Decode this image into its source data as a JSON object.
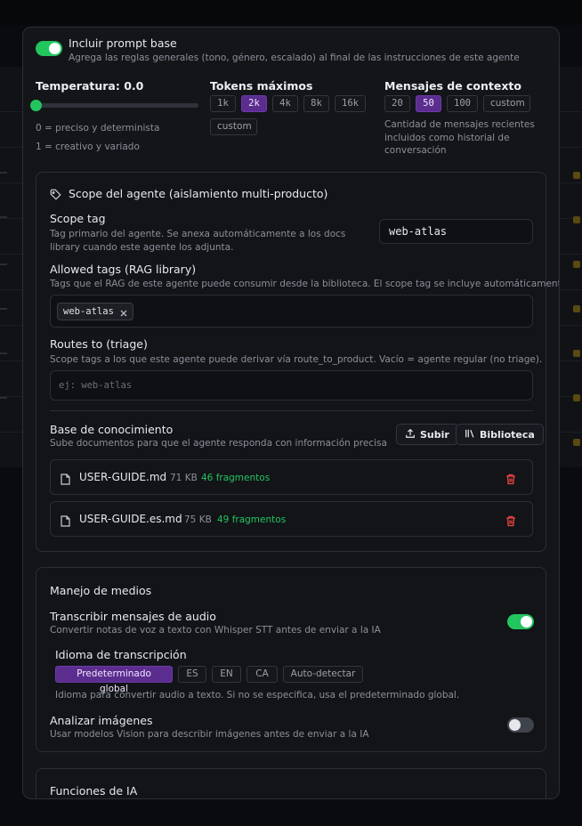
{
  "prompt_base": {
    "enabled": true,
    "title": "Incluir prompt base",
    "description": "Agrega las reglas generales (tono, género, escalado) al final de las instrucciones de este agente"
  },
  "temperature": {
    "title": "Temperatura: 0.0",
    "value": 0.0,
    "hint_low": "0 = preciso y determinista",
    "hint_high": "1 = creativo y variado"
  },
  "max_tokens": {
    "title": "Tokens máximos",
    "options": [
      "1k",
      "2k",
      "4k",
      "8k",
      "16k",
      "custom"
    ],
    "selected": "2k"
  },
  "context_messages": {
    "title": "Mensajes de contexto",
    "options": [
      "20",
      "50",
      "100",
      "custom"
    ],
    "selected": "50",
    "description": "Cantidad de mensajes recientes incluidos como historial de conversación"
  },
  "scope": {
    "title": "Scope del agente (aislamiento multi-producto)",
    "scope_tag_label": "Scope tag",
    "scope_tag_description": "Tag primario del agente. Se anexa automáticamente a los docs library cuando este agente los adjunta.",
    "scope_tag_value": "web-atlas",
    "allowed_tags_label": "Allowed tags (RAG library)",
    "allowed_tags_description": "Tags que el RAG de este agente puede consumir desde la biblioteca. El scope tag se incluye automáticamente.",
    "allowed_tags": [
      "web-atlas"
    ],
    "routes_label": "Routes to (triage)",
    "routes_description": "Scope tags a los que este agente puede derivar vía route_to_product. Vacío = agente regular (no triage).",
    "routes_placeholder": "ej: web-atlas"
  },
  "knowledge": {
    "title": "Base de conocimiento",
    "description": "Sube documentos para que el agente responda con información precisa",
    "upload_label": "Subir",
    "library_label": "Biblioteca",
    "files": [
      {
        "name": "USER-GUIDE.md",
        "size": "71 KB",
        "fragments": "46 fragmentos"
      },
      {
        "name": "USER-GUIDE.es.md",
        "size": "75 KB",
        "fragments": "49 fragmentos"
      }
    ]
  },
  "media": {
    "title": "Manejo de medios",
    "transcribe_title": "Transcribir mensajes de audio",
    "transcribe_description": "Convertir notas de voz a texto con Whisper STT antes de enviar a la IA",
    "transcribe_enabled": true,
    "language_title": "Idioma de transcripción",
    "language_options": [
      "Predeterminado global",
      "ES",
      "EN",
      "CA",
      "Auto-detectar"
    ],
    "language_selected": "Predeterminado global",
    "language_description": "Idioma para convertir audio a texto. Si no se especifica, usa el predeterminado global.",
    "images_title": "Analizar imágenes",
    "images_description": "Usar modelos Vision para describir imágenes antes de enviar a la IA",
    "images_enabled": false
  },
  "ai_functions": {
    "title": "Funciones de IA"
  },
  "colors": {
    "accent_green": "#22c55e",
    "accent_purple": "#5b2d8e",
    "danger_red": "#ef4444"
  }
}
